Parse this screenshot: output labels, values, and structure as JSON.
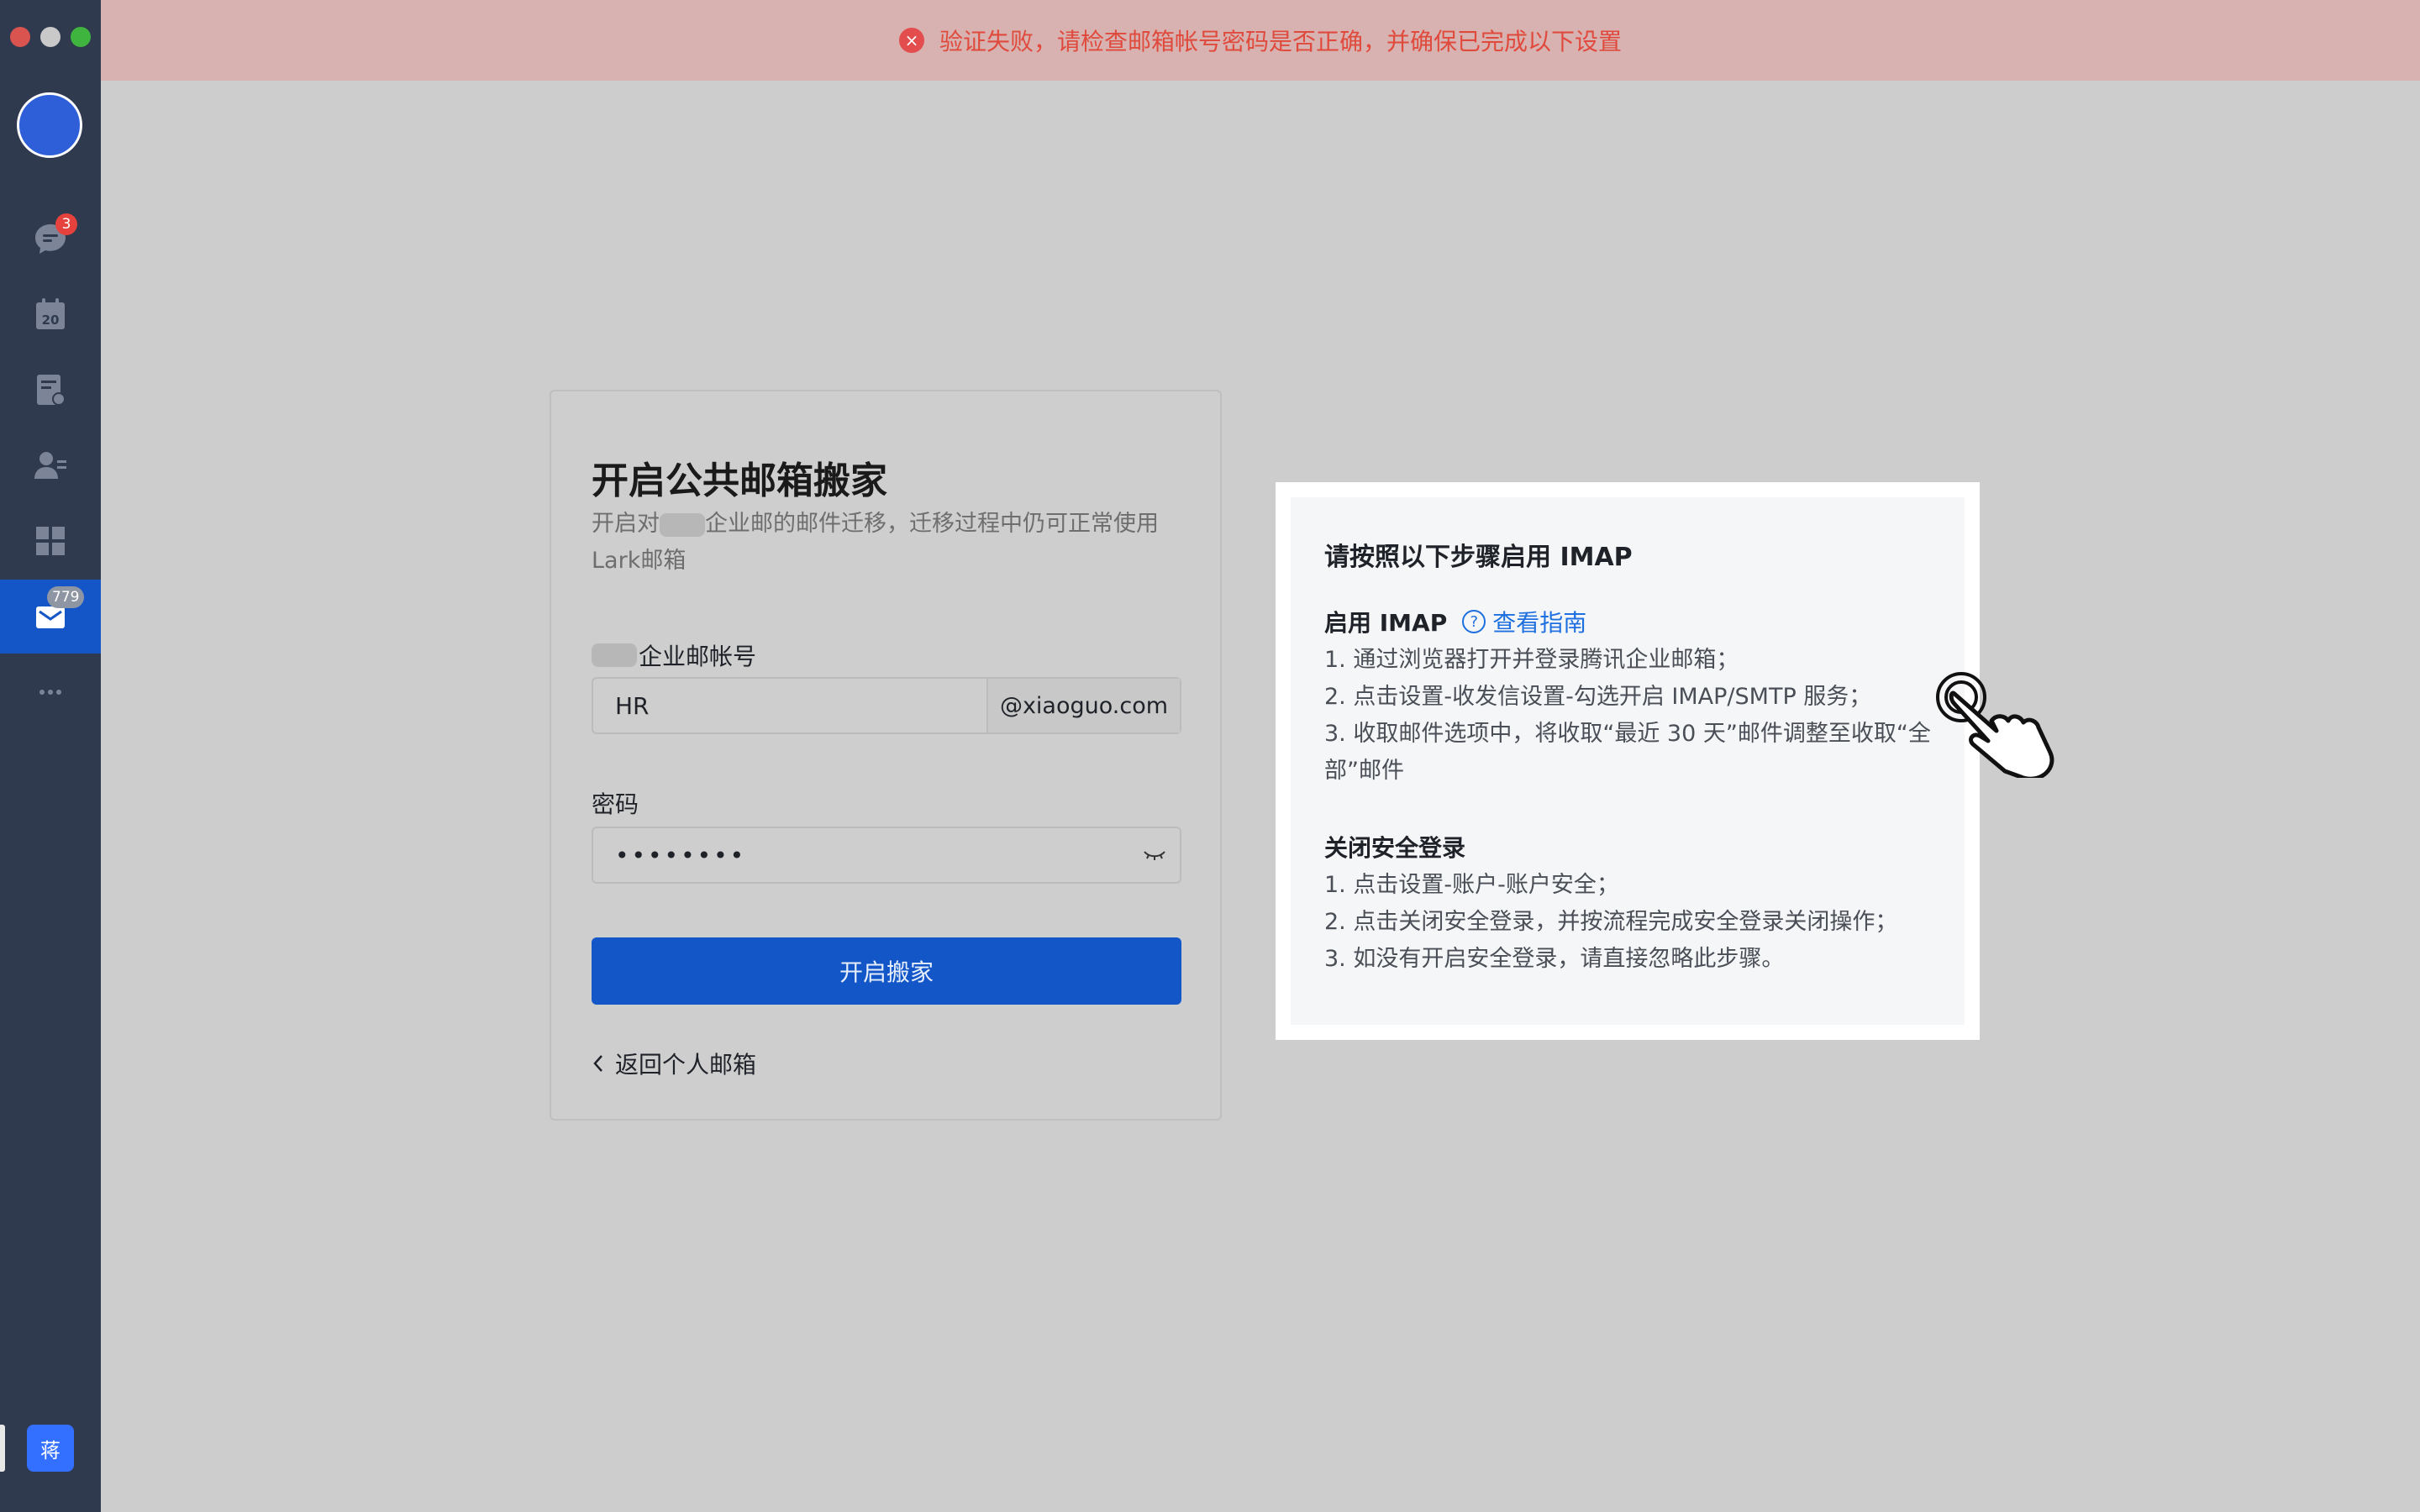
{
  "window": {
    "controls": [
      "close",
      "minimize",
      "zoom"
    ]
  },
  "sidebar": {
    "items": [
      {
        "name": "messages",
        "icon": "chat-icon",
        "badge": "3"
      },
      {
        "name": "calendar",
        "icon": "calendar-icon",
        "date": "20"
      },
      {
        "name": "docs",
        "icon": "doc-edit-icon"
      },
      {
        "name": "contacts",
        "icon": "contacts-icon"
      },
      {
        "name": "workplace",
        "icon": "apps-grid-icon"
      },
      {
        "name": "mail",
        "icon": "mail-icon",
        "badge": "779",
        "active": true
      },
      {
        "name": "more",
        "icon": "more-icon"
      }
    ],
    "user_initial": "蒋"
  },
  "banner": {
    "message": "验证失败，请检查邮箱帐号密码是否正确，并确保已完成以下设置",
    "color": "#e04a3c"
  },
  "form": {
    "title": "开启公共邮箱搬家",
    "subtitle_prefix": "开启对",
    "subtitle_rest": "企业邮的邮件迁移，迁移过程中仍可正常使用Lark邮箱",
    "account_label": "企业邮帐号",
    "account_value": "HR",
    "account_domain": "@xiaoguo.com",
    "password_label": "密码",
    "password_masked": "••••••••",
    "submit_label": "开启搬家",
    "back_label": "返回个人邮箱",
    "accent": "#1356c8"
  },
  "help": {
    "title": "请按照以下步骤启用 IMAP",
    "imap_heading": "启用 IMAP",
    "guide_link": "查看指南",
    "imap_steps": [
      "1. 通过浏览器打开并登录腾讯企业邮箱；",
      "2. 点击设置-收发信设置-勾选开启 IMAP/SMTP 服务；",
      "3. 收取邮件选项中，将收取“最近 30 天”邮件调整至收取“全部”邮件"
    ],
    "security_heading": "关闭安全登录",
    "security_steps": [
      "1. 点击设置-账户-账户安全；",
      "2. 点击关闭安全登录，并按流程完成安全登录关闭操作；",
      "3. 如没有开启安全登录，请直接忽略此步骤。"
    ]
  }
}
